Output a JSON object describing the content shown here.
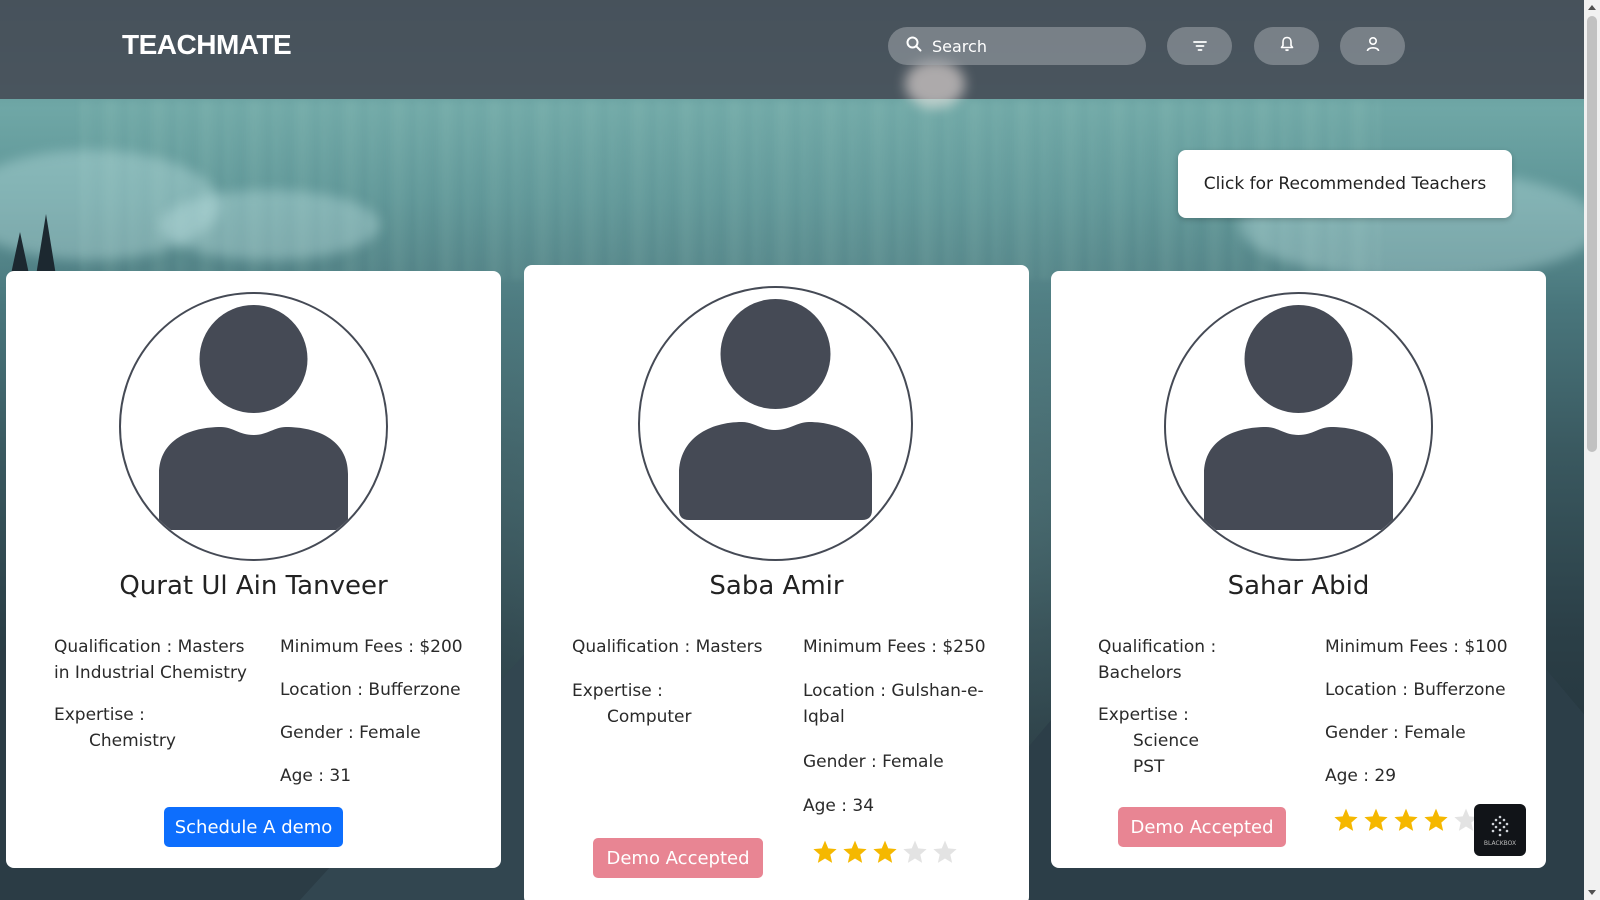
{
  "app": {
    "logo": "TEACHMATE"
  },
  "header": {
    "search": {
      "placeholder": "Search",
      "icon": "search-icon"
    },
    "filter_icon": "filter-icon",
    "notification_icon": "bell-icon",
    "profile_icon": "user-icon"
  },
  "recommend_button": "Click for Recommended Teachers",
  "teachers": [
    {
      "name": "Qurat Ul Ain Tanveer",
      "qualification": "Qualification : Masters in Industrial Chemistry",
      "expertise_label": "Expertise :",
      "expertise": [
        "Chemistry"
      ],
      "min_fees": "Minimum Fees : $200",
      "location": "Location : Bufferzone",
      "gender": "Gender : Female",
      "age": "Age : 31",
      "action": "Schedule A demo",
      "action_type": "schedule",
      "rating": null
    },
    {
      "name": "Saba Amir",
      "qualification": "Qualification : Masters",
      "expertise_label": "Expertise :",
      "expertise": [
        "Computer"
      ],
      "min_fees": "Minimum Fees : $250",
      "location": "Location : Gulshan-e-Iqbal",
      "gender": "Gender : Female",
      "age": "Age : 34",
      "action": "Demo Accepted",
      "action_type": "accepted",
      "rating": 3
    },
    {
      "name": "Sahar Abid",
      "qualification": "Qualification : Bachelors",
      "expertise_label": "Expertise :",
      "expertise": [
        "Science",
        "PST"
      ],
      "min_fees": "Minimum Fees : $100",
      "location": "Location : Bufferzone",
      "gender": "Gender : Female",
      "age": "Age : 29",
      "action": "Demo Accepted",
      "action_type": "accepted",
      "rating": 4
    }
  ],
  "rating_max": 5,
  "colors": {
    "schedule": "#0d6efd",
    "accepted": "#e88593",
    "star_on": "#f5b800",
    "star_off": "#e3e3e3"
  },
  "badge": {
    "label": "BLACKBOX"
  }
}
